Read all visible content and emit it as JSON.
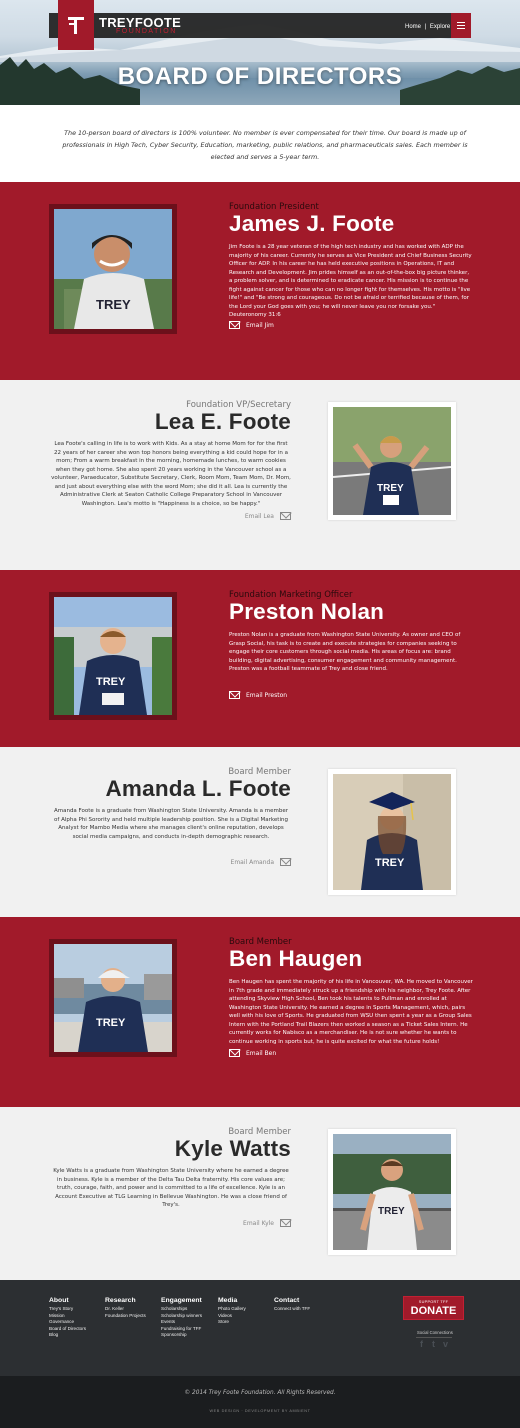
{
  "header": {
    "brand": "TREYFOOTE",
    "brand_sub": "FOUNDATION",
    "nav_home": "Home",
    "nav_sep": "|",
    "nav_explore": "Explore",
    "hero_title": "BOARD OF DIRECTORS",
    "menu_icon": "hamburger-icon"
  },
  "intro": "The 10-person board of directors is 100% volunteer. No member is ever compensated for their time. Our board is made up of professionals in High Tech, Cyber Security, Education, marketing, public relations, and pharmaceuticals sales. Each member is elected and serves a 5-year term.",
  "members": [
    {
      "role": "Foundation President",
      "name": "James J. Foote",
      "bio": "Jim Foote is a 28 year veteran of the high tech industry and has worked with ADP the majority of his career. Currently he serves as Vice President and Chief Business Security Officer for ADP. In his career he has held executive positions in Operations, IT and Research and Development. Jim prides himself as an out-of-the-box big picture thinker, a problem solver, and is determined to eradicate cancer. His mission is to continue the fight against cancer for those who can no longer fight for themselves.  His motto is \"live life!\" and \"Be strong and courageous. Do not be afraid or terrified because of them, for the Lord your God goes with you; he will never leave you nor forsake you.\" Deuteronomy 31:6",
      "email": "Email Jim"
    },
    {
      "role": "Foundation VP/Secretary",
      "name": "Lea E. Foote",
      "bio": "Lea Foote's calling in life is to work with Kids. As a stay at home Mom for for the first 22 years of her career she won top honors being everything a kid could hope for in a mom; From a warm breakfast in the morning, homemade lunches, to warm cookies when they got home. She also spent 20 years working in the Vancouver school as a volunteer, Paraeducator, Substitute Secretary, Clerk, Room Mom, Team Mom, Dr. Mom, and just about everything else with the word Mom; she did it all. Lea is currently the Administrative Clerk at Seaton Catholic College Preparatory School in Vancouver Washington. Lea's motto is \"Happiness is a choice, so be happy.\"",
      "email": "Email Lea"
    },
    {
      "role": "Foundation Marketing Officer",
      "name": "Preston Nolan",
      "bio": "Preston Nolan is a graduate from Washington State University. As owner and CEO of Grasp Social, his task is to create and execute strategies for companies seeking to engage their core customers through social media. His areas of focus are: brand building, digital advertising, consumer engagement and community management. Preston was a football teammate of Trey and close friend.",
      "email": "Email Preston"
    },
    {
      "role": "Board Member",
      "name": "Amanda L. Foote",
      "bio": "Amanda Foote is a graduate from Washington State University. Amanda is a member of Alpha Phi Sorority and held multiple leadership position.  She is a Digital Marketing Analyst for Mambo Media where she manages client's online reputation, develops social media campaigns, and conducts in-depth demographic research.",
      "email": "Email Amanda"
    },
    {
      "role": "Board Member",
      "name": "Ben Haugen",
      "bio": "Ben Haugen has spent the majority of his life in Vancouver, WA.  He moved to Vancouver in 7th grade and immediately struck up a friendship with his neighbor, Trey Foote.  After attending Skyview High School, Ben took his talents to Pullman and enrolled at Washington State University.  He earned a degree in Sports Management, which, pairs well with his love of Sports. He graduated from WSU then spent a year as a Group Sales Intern with the Portland Trail Blazers then worked a season as a Ticket Sales Intern. He currently works for Nabisco as a merchandiser.  He is not sure whether he wants to continue working in sports but, he is quite excited for what the future holds!",
      "email": "Email Ben"
    },
    {
      "role": "Board Member",
      "name": "Kyle Watts",
      "bio": "Kyle Watts is a graduate from Washington State University where he earned a degree in business. Kyle is a member of the Delta Tau Delta fraternity. His core values are; truth, courage, faith, and power and is committed to a life of excellence. Kyle is an Account Executive at TLG Learning in Bellevue Washington.  He was a close friend of Trey's.",
      "email": "Email Kyle"
    }
  ],
  "footer": {
    "columns": [
      {
        "title": "About",
        "links": [
          "Trey's Story",
          "Mission",
          "Governance",
          "Board of Directors",
          "Blog"
        ]
      },
      {
        "title": "Research",
        "links": [
          "Dr. Keller",
          "Foundation Projects"
        ]
      },
      {
        "title": "Engagement",
        "links": [
          "Scholarships",
          "Scholarship winners",
          "Events",
          "Fundraising for TFF",
          "Sponsorship"
        ]
      },
      {
        "title": "Media",
        "links": [
          "Photo Gallery",
          "Videos",
          "Store"
        ]
      },
      {
        "title": "Contact",
        "links": [
          "Connect with TFF"
        ]
      }
    ],
    "donate_small": "SUPPORT TFF",
    "donate_big": "DONATE",
    "social_label": "Social Connections",
    "social_icons": [
      "facebook-icon",
      "twitter-icon",
      "vimeo-icon"
    ],
    "copyright": "© 2014 Trey Foote Foundation. All Rights Reserved.",
    "credit": "WEB DESIGN · DEVELOPMENT BY AMBIENT"
  },
  "colors": {
    "brand_red": "#a11a2a",
    "dark": "#2c2f32",
    "light": "#f1f1f1"
  }
}
